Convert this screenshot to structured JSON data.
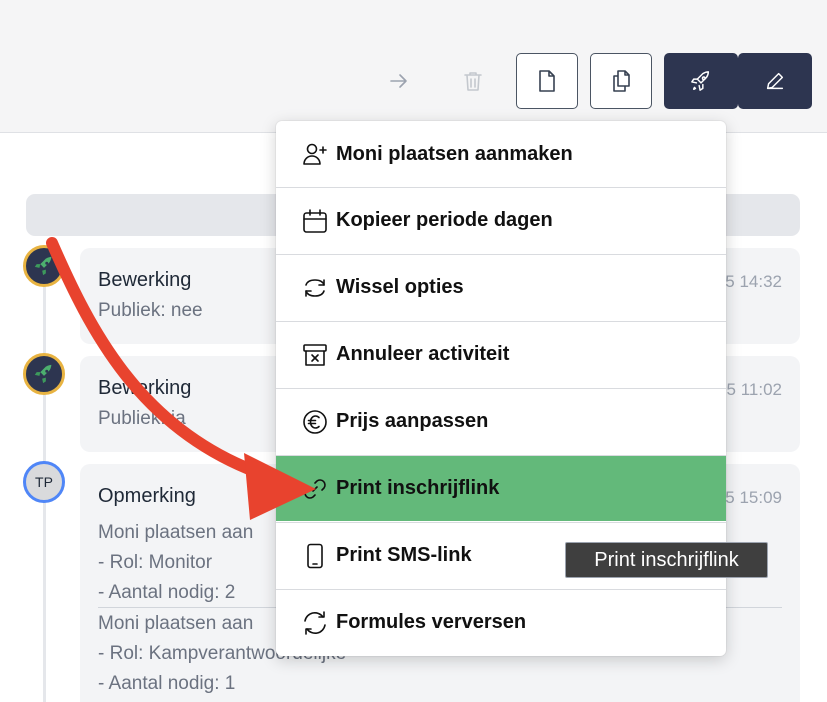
{
  "toolbar": {
    "buttons": [
      {
        "icon": "arrow-right-icon"
      },
      {
        "icon": "trash-icon"
      },
      {
        "icon": "file-icon"
      },
      {
        "icon": "copy-files-icon"
      },
      {
        "icon": "rocket-icon"
      },
      {
        "icon": "pencil-icon"
      }
    ],
    "dark_color": "#2d3550"
  },
  "timeline": {
    "entries": [
      {
        "avatar": "rocket-icon",
        "title": "Bewerking",
        "lines": [
          "Publiek: nee"
        ],
        "time": "5 14:32"
      },
      {
        "avatar": "rocket-icon",
        "title": "Bewerking",
        "lines": [
          "Publiek: ja"
        ],
        "time": "5 11:02"
      },
      {
        "avatar_initials": "TP",
        "title": "Opmerking",
        "lines": [
          "Moni plaatsen aan",
          "- Rol: Monitor",
          "- Aantal nodig: 2",
          "Moni plaatsen aan",
          "- Rol: Kampverantwoordelijke",
          "- Aantal nodig: 1"
        ],
        "time": "5 15:09"
      }
    ]
  },
  "menu": {
    "items": [
      {
        "label": "Moni plaatsen aanmaken",
        "icon": "user-plus-icon"
      },
      {
        "label": "Kopieer periode dagen",
        "icon": "calendar-icon"
      },
      {
        "label": "Wissel opties",
        "icon": "swap-icon"
      },
      {
        "label": "Annuleer activiteit",
        "icon": "archive-x-icon"
      },
      {
        "label": "Prijs aanpassen",
        "icon": "euro-icon"
      },
      {
        "label": "Print inschrijflink",
        "icon": "link-icon",
        "active": true
      },
      {
        "label": "Print SMS-link",
        "icon": "phone-icon"
      },
      {
        "label": "Formules verversen",
        "icon": "refresh-icon"
      }
    ],
    "active_color": "#63b97a"
  },
  "tooltip": {
    "text": "Print inschrijflink"
  },
  "annotation": {
    "arrow_color": "#e8432e"
  }
}
